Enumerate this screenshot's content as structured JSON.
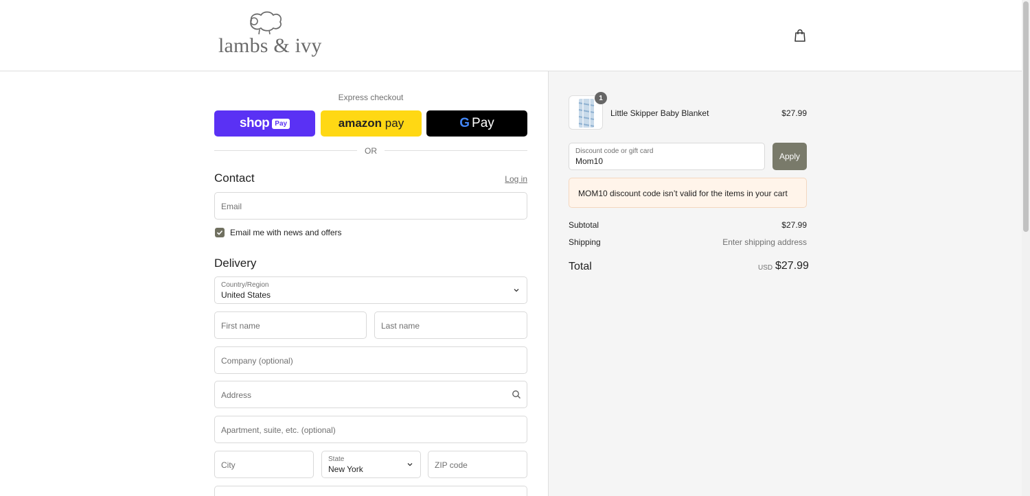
{
  "header": {
    "brand_name": "lambs & ivy",
    "cart_icon": "shopping-bag-icon"
  },
  "express": {
    "label": "Express checkout",
    "shop_pay": {
      "text": "shop",
      "badge": "Pay",
      "color": "#5a31f4"
    },
    "amazon_pay": {
      "brand": "amazon",
      "text": "pay",
      "color": "#ffd814"
    },
    "google_pay": {
      "g": "G",
      "text": "Pay",
      "color": "#000000"
    },
    "or_label": "OR"
  },
  "contact": {
    "title": "Contact",
    "login_link": "Log in",
    "email_placeholder": "Email",
    "newsletter_label": "Email me with news and offers",
    "newsletter_checked": true
  },
  "delivery": {
    "title": "Delivery",
    "country_label": "Country/Region",
    "country_value": "United States",
    "first_name_placeholder": "First name",
    "last_name_placeholder": "Last name",
    "company_placeholder": "Company (optional)",
    "address_placeholder": "Address",
    "apartment_placeholder": "Apartment, suite, etc. (optional)",
    "city_placeholder": "City",
    "state_label": "State",
    "state_value": "New York",
    "zip_placeholder": "ZIP code"
  },
  "summary": {
    "item": {
      "name": "Little Skipper Baby Blanket",
      "price": "$27.99",
      "quantity": "1"
    },
    "discount": {
      "label": "Discount code or gift card",
      "value": "Mom10",
      "apply_label": "Apply",
      "error": "MOM10 discount code isn’t valid for the items in your cart"
    },
    "subtotal_label": "Subtotal",
    "subtotal_value": "$27.99",
    "shipping_label": "Shipping",
    "shipping_value": "Enter shipping address",
    "total_label": "Total",
    "total_currency": "USD",
    "total_value": "$27.99"
  }
}
